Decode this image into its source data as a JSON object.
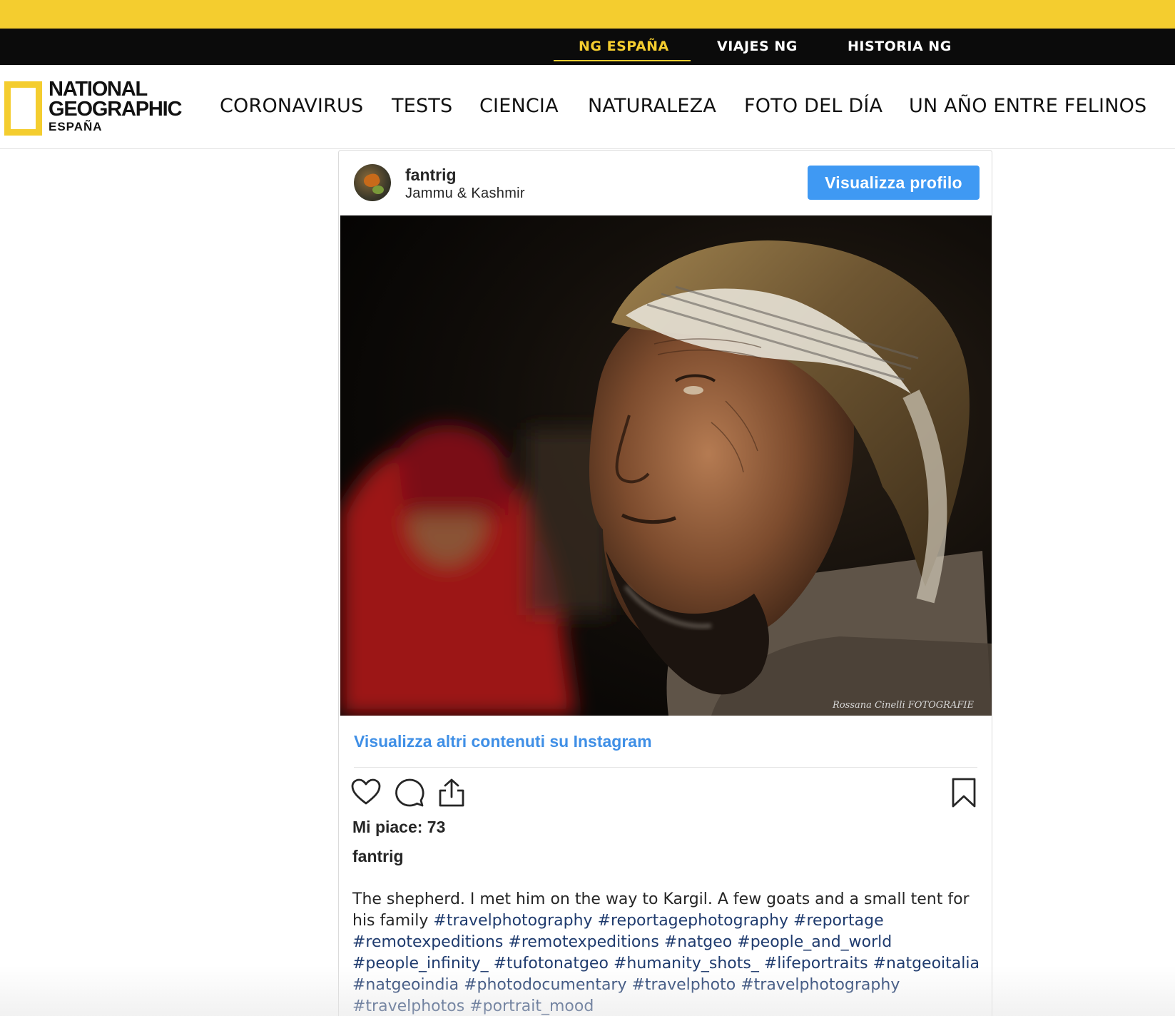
{
  "brand_bar": {
    "links": [
      {
        "label": "NG ESPAÑA",
        "active": true
      },
      {
        "label": "VIAJES NG",
        "active": false
      },
      {
        "label": "HISTORIA NG",
        "active": false
      }
    ]
  },
  "logo": {
    "line1": "NATIONAL",
    "line2": "GEOGRAPHIC",
    "line3": "ESPAÑA"
  },
  "main_nav": {
    "items": [
      "CORONAVIRUS",
      "TESTS",
      "CIENCIA",
      "NATURALEZA",
      "FOTO DEL DÍA",
      "UN AÑO ENTRE FELINOS"
    ]
  },
  "post": {
    "username": "fantrig",
    "location": "Jammu & Kashmir",
    "profile_button": "Visualizza profilo",
    "photo_watermark": "Rossana Cinelli FOTOGRAFIE",
    "more_link": "Visualizza altri contenuti su Instagram",
    "likes": "Mi piace: 73",
    "caption_user": "fantrig",
    "caption_text": "The shepherd. I met him on the way to Kargil. A few goats and a small tent for his family",
    "hashtags": [
      "#travelphotography",
      "#reportagephotography",
      "#reportage",
      "#remotexpeditions",
      "#remotexpeditions",
      "#natgeo",
      "#people_and_world",
      "#people_infinity_",
      "#tufotonatgeo",
      "#humanity_shots_",
      "#lifeportraits",
      "#natgeoitalia",
      "#natgeoindia",
      "#photodocumentary",
      "#travelphoto",
      "#travelphotography",
      "#travelphotos",
      "#portrait_mood"
    ],
    "icons": [
      "heart-icon",
      "comment-icon",
      "share-icon",
      "bookmark-icon"
    ]
  },
  "colors": {
    "brand_yellow": "#f4cd2f",
    "brand_black": "#0b0b0b",
    "instagram_blue": "#3f99f3",
    "link_blue": "#3f8fe6",
    "hashtag_navy": "#1f3b6e"
  }
}
